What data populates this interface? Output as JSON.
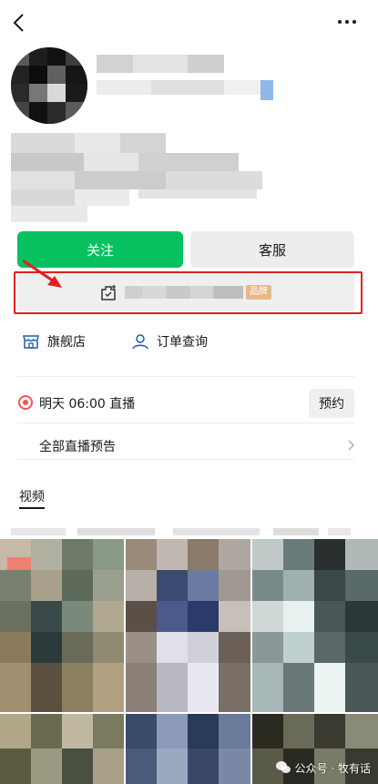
{
  "header": {
    "back_icon": "chevron-left-icon",
    "more_icon": "more-horizontal-icon"
  },
  "actions": {
    "follow_label": "关注",
    "service_label": "客服",
    "follow_color": "#07c160"
  },
  "brand": {
    "badge": "品牌",
    "icon": "brand-auth-icon"
  },
  "shop": {
    "flagship_label": "旗舰店",
    "orders_label": "订单查询"
  },
  "live": {
    "schedule_text": "明天 06:00 直播",
    "reserve_label": "预约",
    "all_label": "全部直播预告"
  },
  "tabs": {
    "video_label": "视频"
  },
  "watermark": {
    "text": "公众号 · 牧有话"
  },
  "colors": {
    "highlight_red": "#e02020",
    "badge_gold": "#e6b98a",
    "live_red": "#fa5151"
  }
}
